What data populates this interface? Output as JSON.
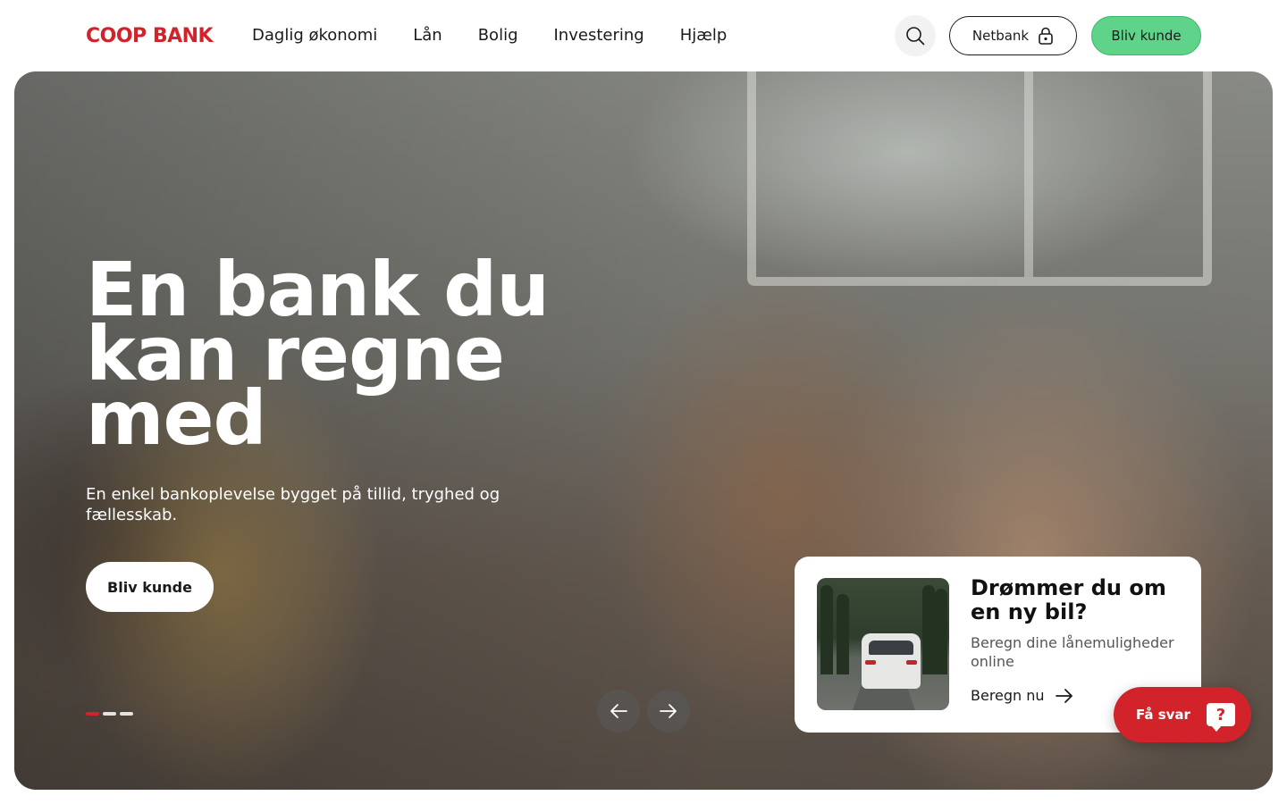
{
  "brand": {
    "name": "COOP BANK",
    "color": "#d2232a"
  },
  "nav": {
    "items": [
      {
        "label": "Daglig økonomi"
      },
      {
        "label": "Lån"
      },
      {
        "label": "Bolig"
      },
      {
        "label": "Investering"
      },
      {
        "label": "Hjælp"
      }
    ]
  },
  "header": {
    "search_icon": "search-icon",
    "netbank_label": "Netbank",
    "netbank_icon": "lock-icon",
    "cta_label": "Bliv kunde",
    "cta_color": "#5fd38a"
  },
  "hero": {
    "title": "En bank du kan regne med",
    "subtitle": "En enkel bankoplevelse bygget på tillid, tryghed og fællesskab.",
    "cta_label": "Bliv kunde",
    "slides": {
      "count": 3,
      "active": 1
    }
  },
  "promo": {
    "title": "Drømmer du om en ny bil?",
    "description": "Beregn dine lånemuligheder online",
    "link_label": "Beregn nu",
    "link_icon": "arrow-right-icon"
  },
  "chat": {
    "label": "Få svar",
    "icon_glyph": "?",
    "color": "#d2232a"
  }
}
